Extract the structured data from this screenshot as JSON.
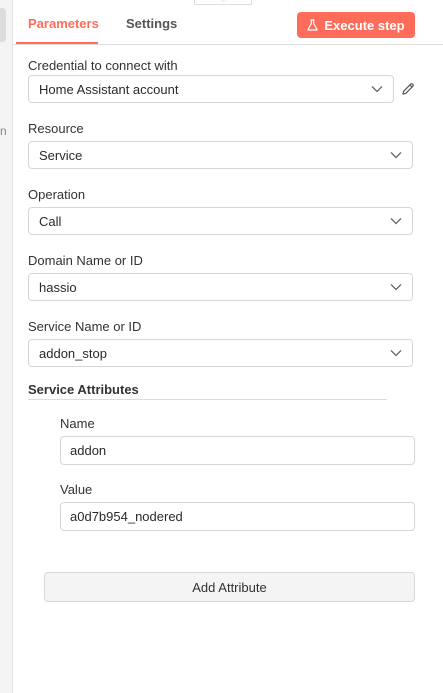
{
  "tabs": {
    "parameters": "Parameters",
    "settings": "Settings"
  },
  "actions": {
    "execute_step": "Execute step"
  },
  "fields": {
    "credential": {
      "label": "Credential to connect with",
      "value": "Home Assistant account"
    },
    "resource": {
      "label": "Resource",
      "value": "Service"
    },
    "operation": {
      "label": "Operation",
      "value": "Call"
    },
    "domain": {
      "label": "Domain Name or ID",
      "value": "hassio"
    },
    "service": {
      "label": "Service Name or ID",
      "value": "addon_stop"
    }
  },
  "service_attributes": {
    "title": "Service Attributes",
    "name_label": "Name",
    "name_value": "addon",
    "value_label": "Value",
    "value_value": "a0d7b954_nodered",
    "add_button": "Add Attribute"
  },
  "colors": {
    "accent": "#ff6d5a",
    "border": "#d7d7d7"
  }
}
